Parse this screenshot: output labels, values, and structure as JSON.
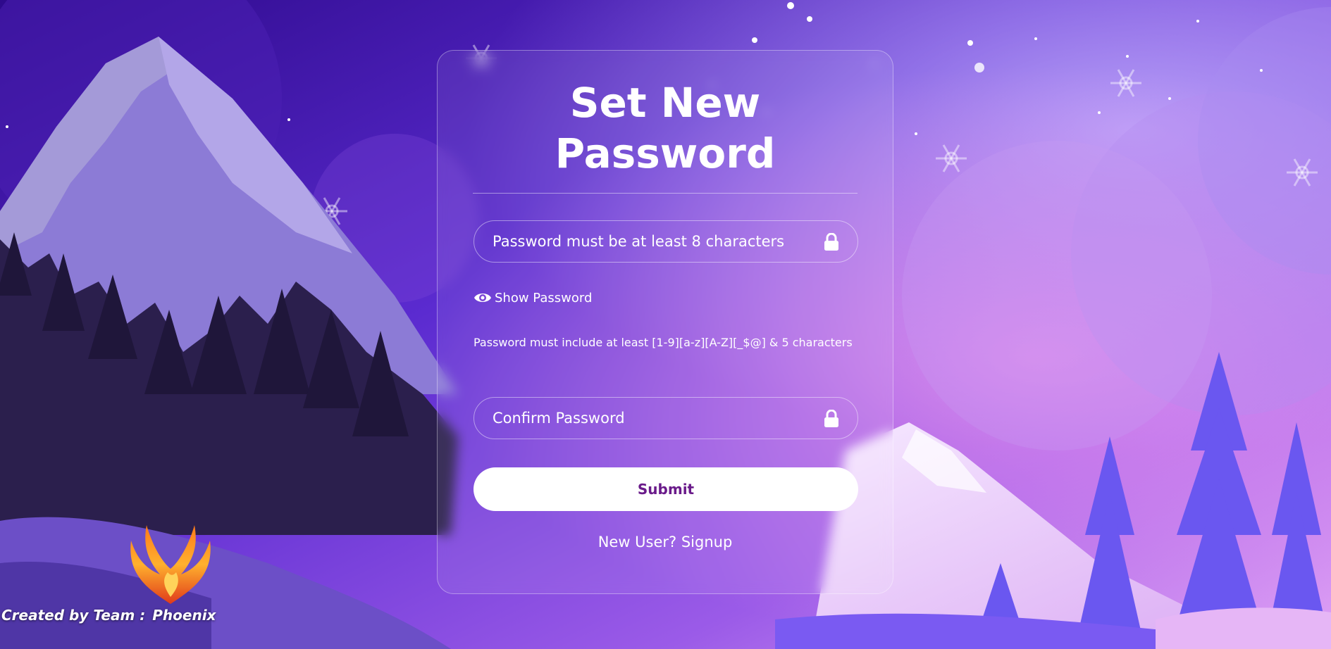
{
  "card": {
    "title_line1": "Set New",
    "title_line2": "Password",
    "password_placeholder": "Password must be at least 8 characters",
    "show_password_label": "Show Password",
    "hint": "Password must include at least [1-9][a-z][A-Z][_$@] & 5 characters",
    "confirm_placeholder": "Confirm Password",
    "submit_label": "Submit",
    "signup_label": "New User? Signup"
  },
  "footer": {
    "created_by": "Created by Team :",
    "team_name": "Phoenix"
  },
  "icons": {
    "password_lock": "lock-icon",
    "confirm_lock": "lock-icon",
    "show_password": "eye-icon",
    "logo": "phoenix-logo"
  },
  "colors": {
    "background_top": "#3a0e9a",
    "background_bottom": "#c777f0",
    "submit_text": "#6a1b8a",
    "submit_bg": "#ffffff"
  }
}
